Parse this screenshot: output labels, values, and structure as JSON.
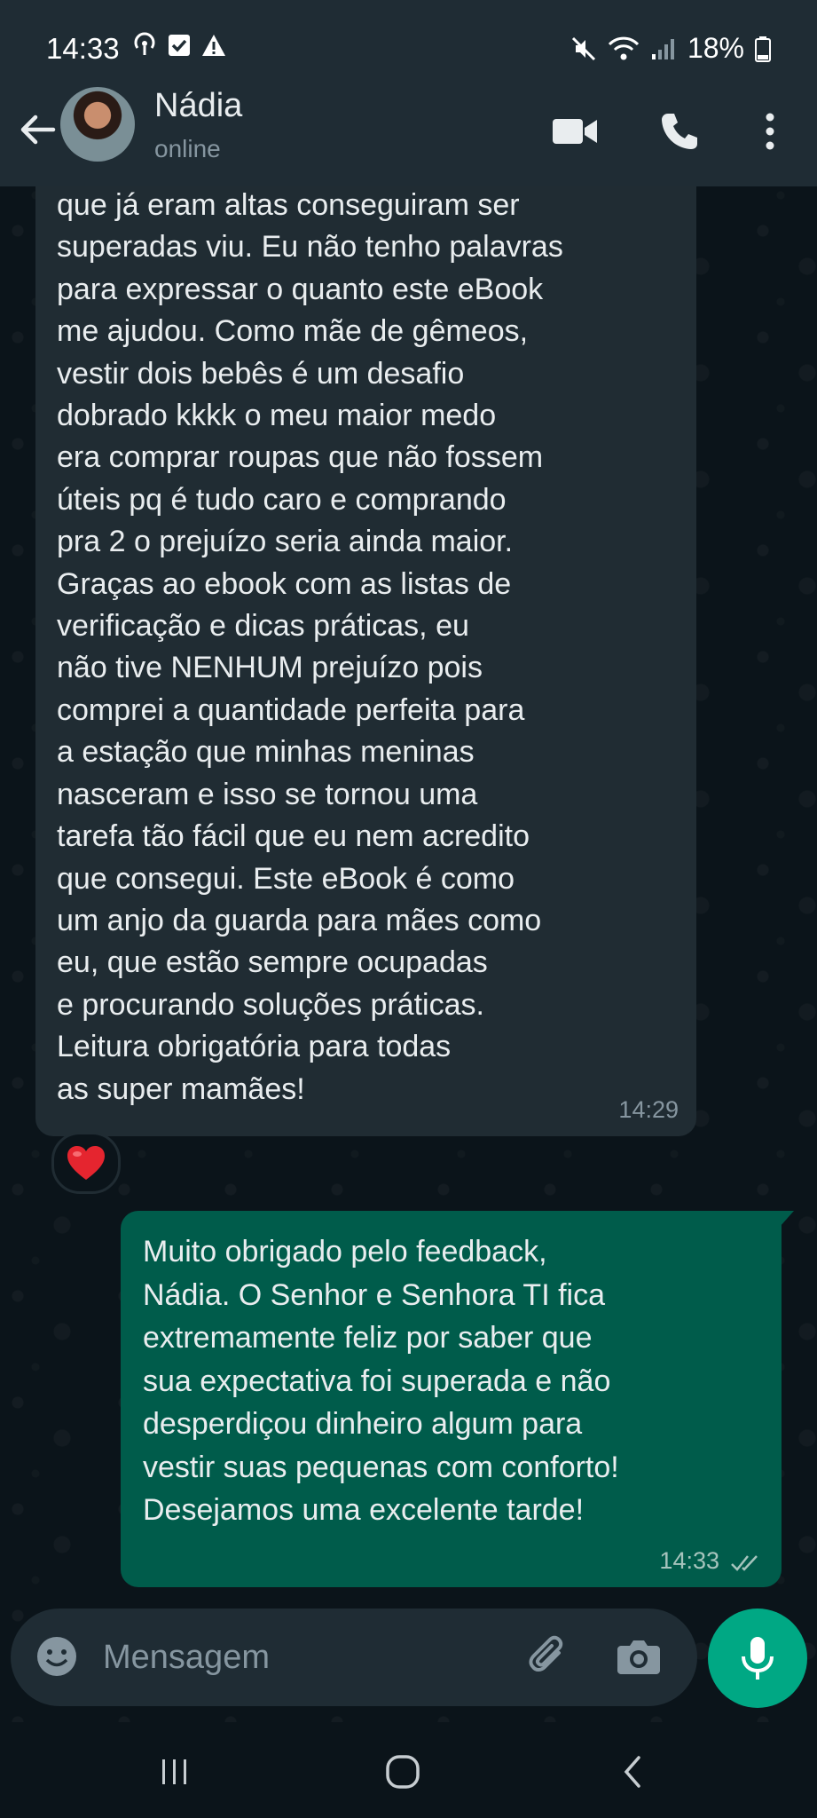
{
  "status_bar": {
    "time": "14:33",
    "battery": "18%"
  },
  "contact": {
    "name": "Nádia",
    "status": "online"
  },
  "messages": {
    "incoming": {
      "text": "que já eram altas conseguiram ser\nsuperadas viu. Eu não tenho palavras\npara expressar o quanto este eBook\nme ajudou. Como mãe de gêmeos,\nvestir dois bebês é um desafio\ndobrado kkkk o meu maior medo\nera comprar roupas que não fossem\núteis pq é tudo caro e comprando\npra 2 o prejuízo seria ainda maior.\nGraças ao ebook com as listas de\nverificação e dicas práticas, eu\nnão tive NENHUM prejuízo pois\ncomprei a quantidade perfeita para\na estação que minhas meninas\nnasceram e isso se tornou uma\ntarefa tão fácil que eu nem acredito\nque consegui. Este eBook é como\num anjo da guarda para mães como\neu, que estão sempre ocupadas\ne procurando soluções práticas.\nLeitura obrigatória para todas\nas super mamães!",
      "time": "14:29",
      "reaction": "❤️"
    },
    "outgoing": {
      "text": "Muito obrigado pelo feedback,\nNádia. O Senhor e Senhora TI fica\nextremamente feliz por saber que\nsua expectativa foi superada e não\ndesperdiçou dinheiro algum para\nvestir suas pequenas com conforto!\nDesejamos uma excelente tarde!",
      "time": "14:33"
    }
  },
  "composer": {
    "placeholder": "Mensagem"
  },
  "colors": {
    "header": "#1f2c34",
    "incoming_bubble": "#202c33",
    "outgoing_bubble": "#005c4b",
    "accent": "#00a884",
    "background": "#0b141a"
  },
  "icons": {
    "back": "arrow-left-icon",
    "video": "video-call-icon",
    "phone": "phone-icon",
    "menu": "more-vertical-icon",
    "emoji": "emoji-icon",
    "attach": "paperclip-icon",
    "camera": "camera-icon",
    "mic": "microphone-icon",
    "read": "double-check-icon"
  }
}
